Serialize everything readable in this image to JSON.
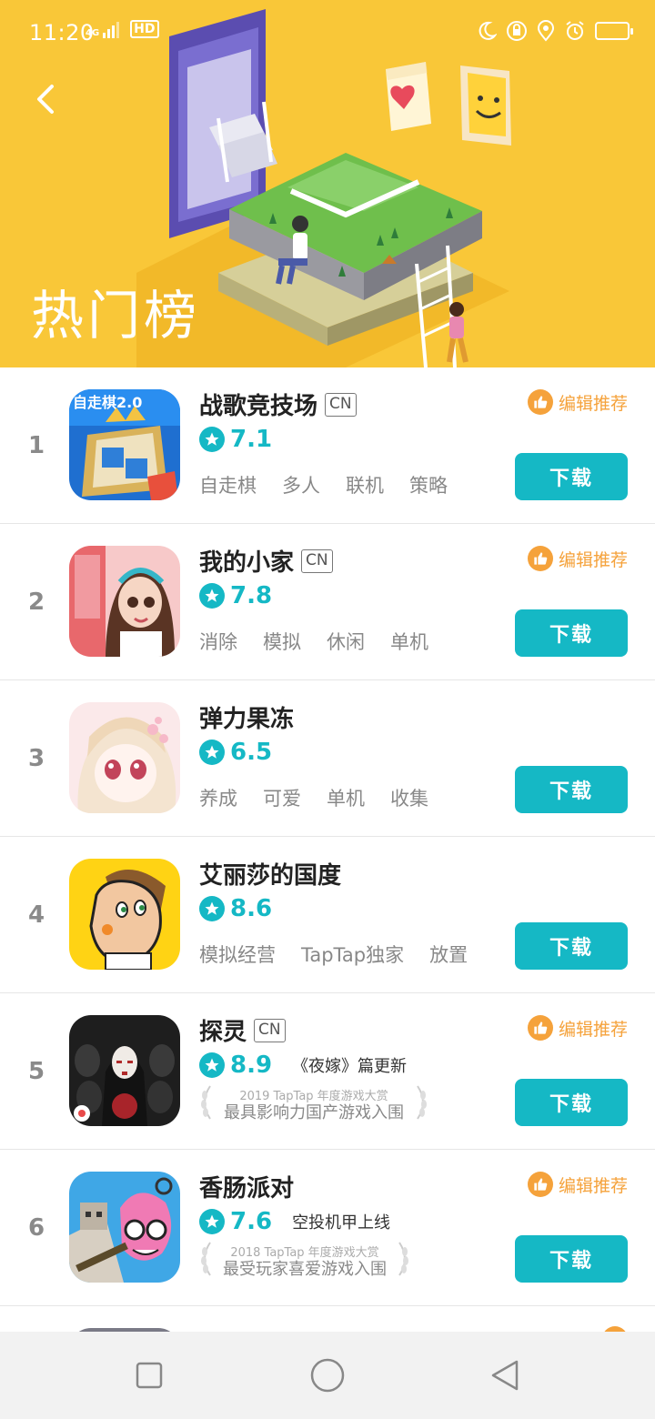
{
  "status_bar": {
    "time": "11:20",
    "net_small": "4G",
    "hd": "HD",
    "icons": [
      "moon-icon",
      "rotation-lock-icon",
      "location-icon",
      "alarm-icon",
      "battery-icon"
    ]
  },
  "header": {
    "title": "热门榜",
    "background_color": "#f9c738"
  },
  "labels": {
    "download": "下载",
    "editor_pick": "编辑推荐",
    "cn": "CN"
  },
  "colors": {
    "accent_teal": "#15b8c5",
    "editor_orange": "#f5a23b"
  },
  "apps": [
    {
      "rank": "1",
      "name": "战歌竞技场",
      "cn": true,
      "rating": "7.1",
      "editor_pick": true,
      "tags": [
        "自走棋",
        "多人",
        "联机",
        "策略"
      ]
    },
    {
      "rank": "2",
      "name": "我的小家",
      "cn": true,
      "rating": "7.8",
      "editor_pick": true,
      "tags": [
        "消除",
        "模拟",
        "休闲",
        "单机"
      ]
    },
    {
      "rank": "3",
      "name": "弹力果冻",
      "cn": false,
      "rating": "6.5",
      "editor_pick": false,
      "tags": [
        "养成",
        "可爱",
        "单机",
        "收集"
      ]
    },
    {
      "rank": "4",
      "name": "艾丽莎的国度",
      "cn": false,
      "rating": "8.6",
      "editor_pick": false,
      "tags": [
        "模拟经营",
        "TapTap独家",
        "放置"
      ]
    },
    {
      "rank": "5",
      "name": "探灵",
      "cn": true,
      "rating": "8.9",
      "editor_pick": true,
      "note": "《夜嫁》篇更新",
      "award_small": "2019 TapTap 年度游戏大赏",
      "award_big": "最具影响力国产游戏入围"
    },
    {
      "rank": "6",
      "name": "香肠派对",
      "cn": false,
      "rating": "7.6",
      "editor_pick": true,
      "note": "空投机甲上线",
      "award_small": "2018 TapTap 年度游戏大赏",
      "award_big": "最受玩家喜爱游戏入围"
    }
  ],
  "icon_art": {
    "app1_text": "自走棋2.0"
  },
  "nav": [
    "recent-apps-icon",
    "home-icon",
    "back-icon"
  ]
}
